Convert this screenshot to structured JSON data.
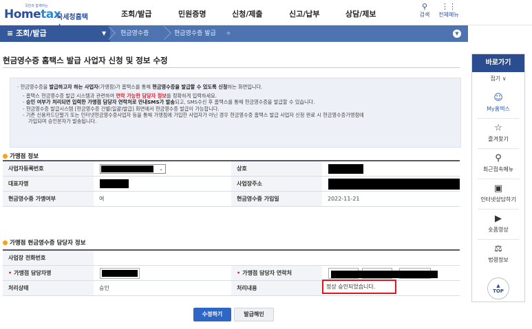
{
  "header": {
    "logo_small": "국민과 함께하는",
    "logo_home": "Home",
    "logo_tax": "tax",
    "logo_agency": "국세청홈택스",
    "gnb": [
      "조회/발급",
      "민원증명",
      "신청/제출",
      "신고/납부",
      "상담/제보"
    ],
    "search_label": "검색",
    "allmenu_label": "전체메뉴"
  },
  "navbar": {
    "menu": "조회/발급",
    "crumb1": "현금영수증",
    "crumb2": "현금영수증 발급"
  },
  "page": {
    "title": "현금영수증 홈택스 발급 사업자 신청 및 정보 수정"
  },
  "info": {
    "line1_pre": "현금영수증을 ",
    "line1_b1": "발급하고자 하는 사업자",
    "line1_mid": "(가맹점)가 홈택스를 통해 ",
    "line1_b2": "현금영수증을 발급할 수 있도록 신청",
    "line1_post": "하는 화면입니다.",
    "line2_pre": "홈택스 현금영수증 발급 시스템과 관련하여 ",
    "line2_red": "연락 가능한 담당자 정보",
    "line2_post": "를 정확하게 입력하세요.",
    "line3_b": "승인 여부가 처리되면 입력한 가맹점 담당자 연락처로 안내SMS가 발송",
    "line3_post": "되고, SMS수신 후 홈택스를 통해 현금영수증을 발급할 수 있습니다.",
    "line4": "현금영수증 발급시스템 [현금영수증 건별(일괄)발급] 화면에서 현금영수증 발급이 가능합니다.",
    "line5a": "기존 신용카드단말기 또는 인터넷현금영수증사업자 등을 통해 가맹점에 가입한 사업자가 아닌 경우 현금영수증 홈택스 발급 사업자 신청 완료 시 현금영수증가맹점에",
    "line5b": "가입되며 승인문자가 발송됩니다."
  },
  "merchant": {
    "section_title": "가맹점 정보",
    "bizno_label": "사업자등록번호",
    "name_label": "상호",
    "rep_label": "대표자명",
    "address_label": "사업장주소",
    "joined_label": "현금영수증 가맹여부",
    "joined_value": "여",
    "joindate_label": "현금영수증 가입일",
    "joindate_value": "2022-11-21"
  },
  "manager": {
    "section_title": "가맹점 현금영수증 담당자 정보",
    "phone_label": "사업장 전화번호",
    "manager_name_label": "가맹점 담당자명",
    "manager_contact_label": "가맹점 담당자 연락처",
    "status_label": "처리상태",
    "status_value": "승인",
    "detail_label": "처리내용",
    "detail_value": "정상 승인되었습니다."
  },
  "buttons": {
    "modify": "수정하기",
    "cancel": "발급해인"
  },
  "quick": {
    "title": "바로가기",
    "fold": "접기 ∨",
    "items": [
      "My홈택스",
      "즐겨찾기",
      "최근접속메뉴",
      "인터넷상담하기",
      "숏폼영상",
      "법령정보"
    ],
    "top": "TOP"
  }
}
